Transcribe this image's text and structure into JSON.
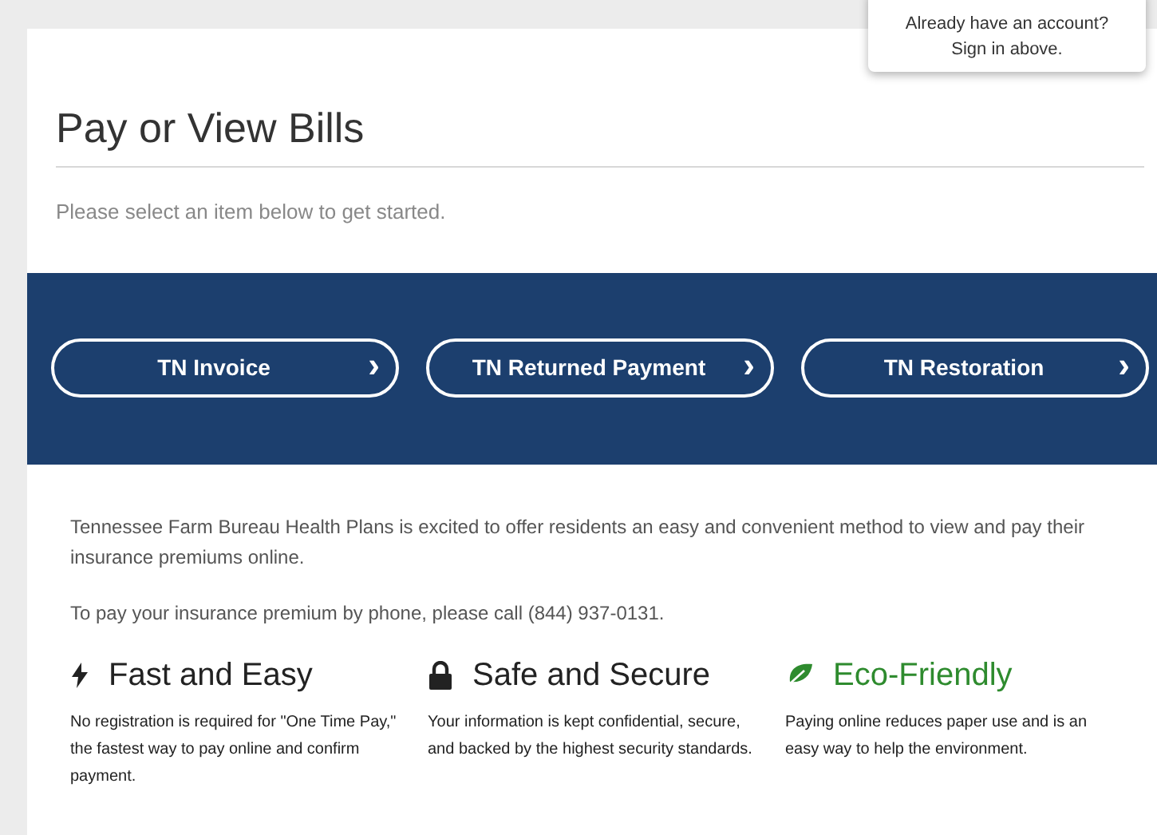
{
  "account_popup": {
    "line_1": "Already have an account?",
    "line_2": "Sign in above."
  },
  "heading": "Pay or View Bills",
  "intro": "Please select an item below to get started.",
  "options": [
    {
      "label": "TN Invoice",
      "icon": "›"
    },
    {
      "label": "TN Returned Payment",
      "icon": "›"
    },
    {
      "label": "TN Restoration",
      "icon": "›"
    }
  ],
  "paragraphs": [
    "Tennessee Farm Bureau Health Plans is excited to offer residents an easy and convenient method to view and pay their insurance premiums online.",
    "To pay your insurance premium by phone, please call (844) 937-0131."
  ],
  "features": [
    {
      "kind": "bolt",
      "title": "Fast and Easy",
      "color": "#222222",
      "text": "No registration is required for \"One Time Pay,\" the fastest way to pay online and confirm payment."
    },
    {
      "kind": "lock",
      "title": "Safe and Secure",
      "color": "#222222",
      "text": "Your information is kept confidential, secure, and backed by the highest security standards."
    },
    {
      "kind": "leaf",
      "title": "Eco-Friendly",
      "color": "#2e8b2e",
      "text": "Paying online reduces paper use and is an easy way to help the environment."
    }
  ]
}
